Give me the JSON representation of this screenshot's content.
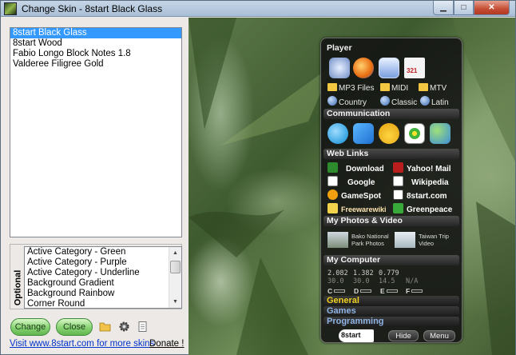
{
  "window": {
    "title": "Change Skin - 8start Black Glass"
  },
  "title_buttons": {
    "min": "▁",
    "max": "□",
    "close": "✕"
  },
  "skins": [
    "8start Black Glass",
    "8start Wood",
    "Fabio Longo Block Notes 1.8",
    "Valderee Filigree Gold"
  ],
  "selected_skin_index": 0,
  "optional": {
    "label": "Optional",
    "items": [
      "Active Category - Green",
      "Active Category - Purple",
      "Active Category - Underline",
      "Background Gradient",
      "Background Rainbow",
      "Corner Round"
    ]
  },
  "buttons": {
    "change": "Change",
    "close": "Close"
  },
  "links": {
    "visit": "Visit www.8start.com for more skins",
    "donate": "Donate !"
  },
  "panel": {
    "player": {
      "heading": "Player",
      "folders": [
        "MP3 Files",
        "MIDI",
        "MTV"
      ],
      "radios": [
        "Country",
        "Classic",
        "Latin"
      ],
      "calendar_number": "321"
    },
    "communication": {
      "heading": "Communication"
    },
    "weblinks": {
      "heading": "Web Links",
      "items": [
        "Download",
        "Yahoo! Mail",
        "Google",
        "Wikipedia",
        "GameSpot",
        "8start.com",
        "Freewarewiki",
        "Greenpeace"
      ]
    },
    "photos": {
      "heading": "My Photos & Video",
      "items": [
        {
          "line1": "Bako National",
          "line2": "Park Photos"
        },
        {
          "line1": "Taiwan Trip",
          "line2": "Video"
        }
      ]
    },
    "computer": {
      "heading": "My Computer",
      "row1": [
        "2.082",
        "1.382",
        "0.779"
      ],
      "row2": [
        "30.0",
        "30.0",
        "14.5",
        "N/A"
      ],
      "drives": [
        "C",
        "D",
        "E",
        "F"
      ]
    },
    "tabs": [
      "General",
      "Games",
      "Programming"
    ],
    "logo": "8start",
    "hide": "Hide",
    "menu": "Menu"
  },
  "colors": {
    "selection": "#3399ff",
    "active_tab": "#f0d020",
    "tab": "#8fb4e6",
    "link": "#0033cc"
  }
}
